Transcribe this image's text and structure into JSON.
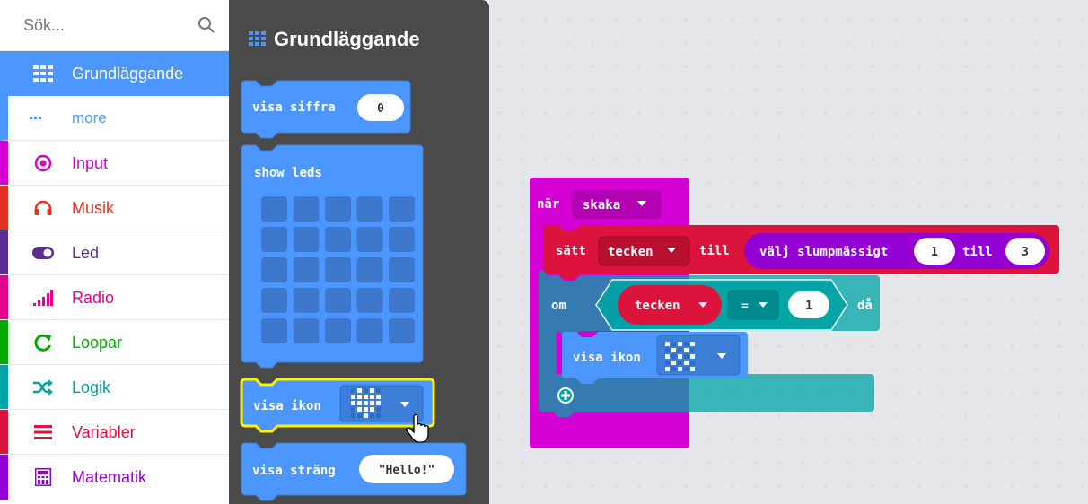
{
  "search": {
    "placeholder": "Sök..."
  },
  "categories": [
    {
      "label": "Grundläggande",
      "color": "#4c97ff",
      "icon": "grid-icon"
    },
    {
      "label": "more",
      "color": "#4c97ff",
      "icon": "dots-icon"
    },
    {
      "label": "Input",
      "color": "#d400d4",
      "icon": "target-icon"
    },
    {
      "label": "Musik",
      "color": "#e63022",
      "icon": "headphones-icon"
    },
    {
      "label": "Led",
      "color": "#5c2d91",
      "icon": "toggle-icon"
    },
    {
      "label": "Radio",
      "color": "#e3008c",
      "icon": "signal-icon"
    },
    {
      "label": "Loopar",
      "color": "#00aa00",
      "icon": "refresh-icon"
    },
    {
      "label": "Logik",
      "color": "#00a4a6",
      "icon": "shuffle-icon"
    },
    {
      "label": "Variabler",
      "color": "#dc143c",
      "icon": "lines-icon"
    },
    {
      "label": "Matematik",
      "color": "#9400d3",
      "icon": "calculator-icon"
    }
  ],
  "flyout": {
    "title": "Grundläggande",
    "blocks": {
      "show_number": {
        "label": "visa siffra",
        "value": "0"
      },
      "show_leds": {
        "label": "show leds"
      },
      "show_icon": {
        "label": "visa ikon"
      },
      "show_string": {
        "label": "visa sträng",
        "value": "\"Hello!\""
      }
    }
  },
  "workspace": {
    "event": {
      "label": "när",
      "dropdown": "skaka"
    },
    "set": {
      "label": "sätt",
      "variable": "tecken",
      "till": "till"
    },
    "random": {
      "label": "välj slumpmässigt",
      "from": "1",
      "till": "till",
      "to": "3"
    },
    "if": {
      "label": "om",
      "variable": "tecken",
      "operator": "=",
      "value": "1",
      "then": "då"
    },
    "show_icon": {
      "label": "visa ikon"
    }
  },
  "colors": {
    "basic": "#4c97ff",
    "input": "#d400d4",
    "variables": "#dc143c",
    "math": "#9400d3",
    "logic": "#00a4a6",
    "highlight": "#fff200"
  }
}
